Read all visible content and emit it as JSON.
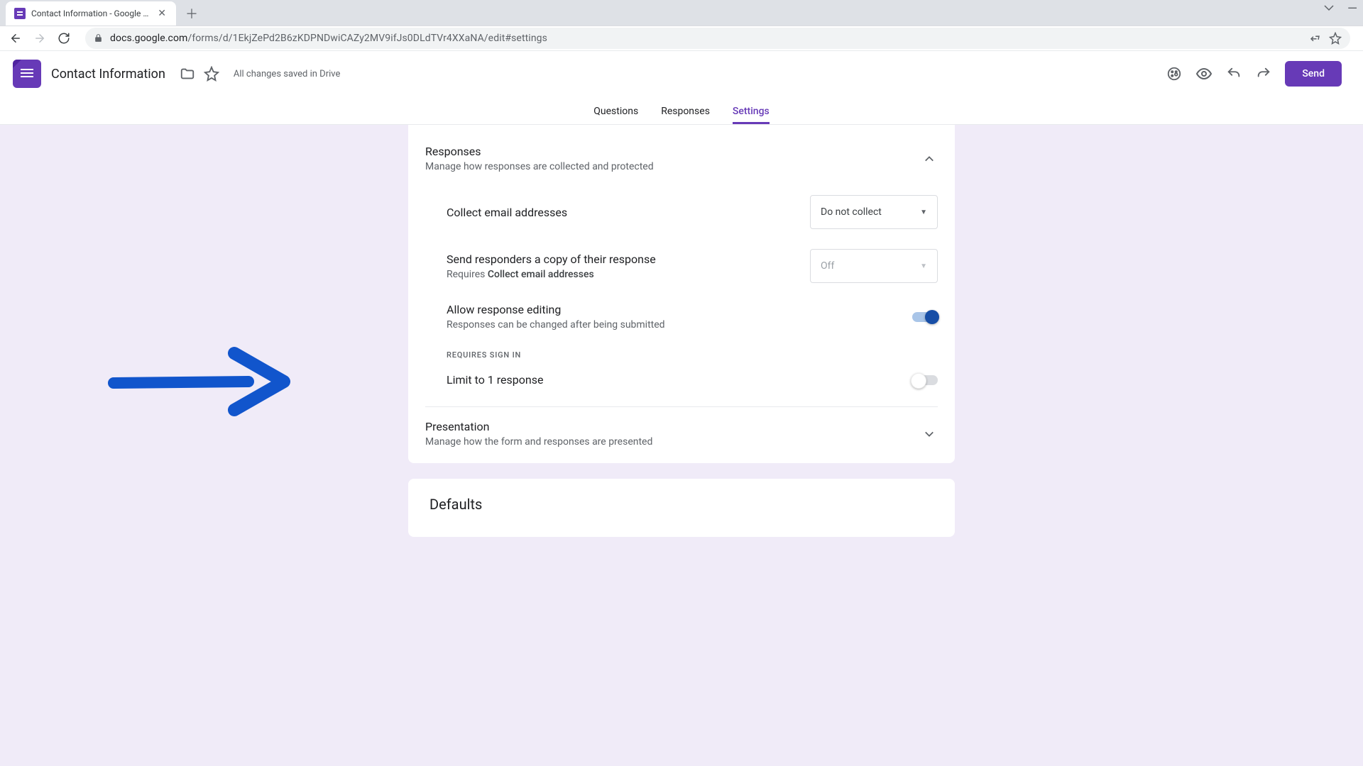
{
  "browser": {
    "tab_title": "Contact Information - Google Forms",
    "url_domain": "docs.google.com",
    "url_path": "/forms/d/1EkjZePd2B6zKDPNDwiCAZy2MV9ifJs0DLdTVr4XXaNA/edit#settings"
  },
  "app": {
    "form_title": "Contact Information",
    "save_status": "All changes saved in Drive",
    "send_button": "Send"
  },
  "tabs": {
    "questions": "Questions",
    "responses": "Responses",
    "settings": "Settings"
  },
  "responses_section": {
    "title": "Responses",
    "subtitle": "Manage how responses are collected and protected",
    "collect_email": {
      "label": "Collect email addresses",
      "value": "Do not collect"
    },
    "send_copy": {
      "label": "Send responders a copy of their response",
      "desc_prefix": "Requires ",
      "desc_bold": "Collect email addresses",
      "value": "Off"
    },
    "allow_edit": {
      "label": "Allow response editing",
      "desc": "Responses can be changed after being submitted"
    },
    "signin_header": "REQUIRES SIGN IN",
    "limit_one": {
      "label": "Limit to 1 response"
    }
  },
  "presentation_section": {
    "title": "Presentation",
    "subtitle": "Manage how the form and responses are presented"
  },
  "defaults_section": {
    "title": "Defaults"
  }
}
